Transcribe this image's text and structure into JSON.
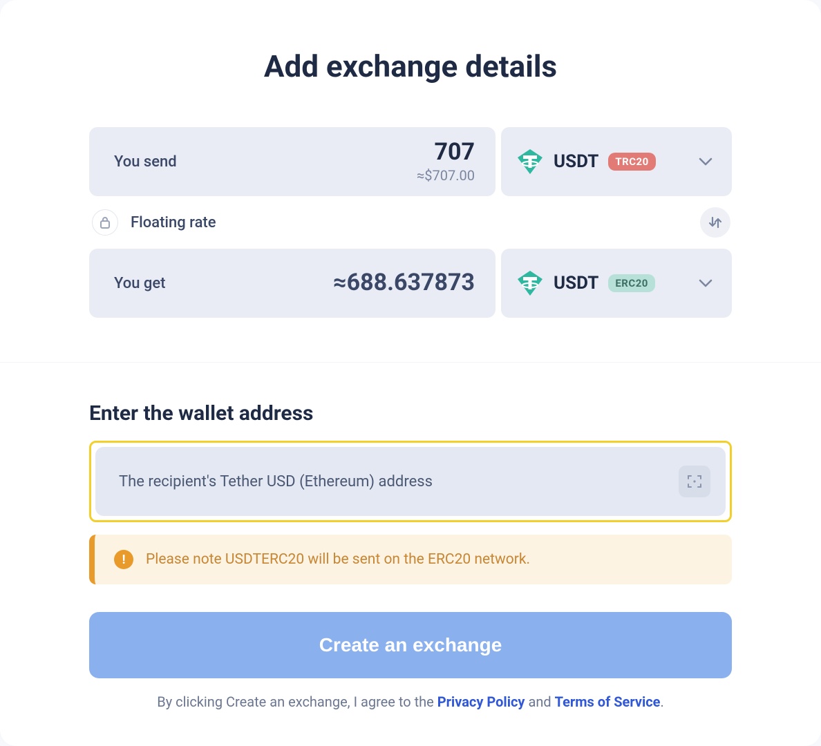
{
  "title": "Add exchange details",
  "send": {
    "label": "You send",
    "amount": "707",
    "approx": "≈$707.00",
    "currency": "USDT",
    "network_badge": "TRC20"
  },
  "rate": {
    "label": "Floating rate"
  },
  "get": {
    "label": "You get",
    "amount": "≈688.637873",
    "currency": "USDT",
    "network_badge": "ERC20"
  },
  "wallet": {
    "section_title": "Enter the wallet address",
    "placeholder": "The recipient's Tether USD (Ethereum) address"
  },
  "notice": {
    "text": "Please note USDTERC20 will be sent on the ERC20 network."
  },
  "cta": "Create an exchange",
  "agree": {
    "prefix": "By clicking Create an exchange, I agree to the ",
    "privacy": "Privacy Policy",
    "and": " and ",
    "tos": "Terms of Service",
    "suffix": "."
  }
}
